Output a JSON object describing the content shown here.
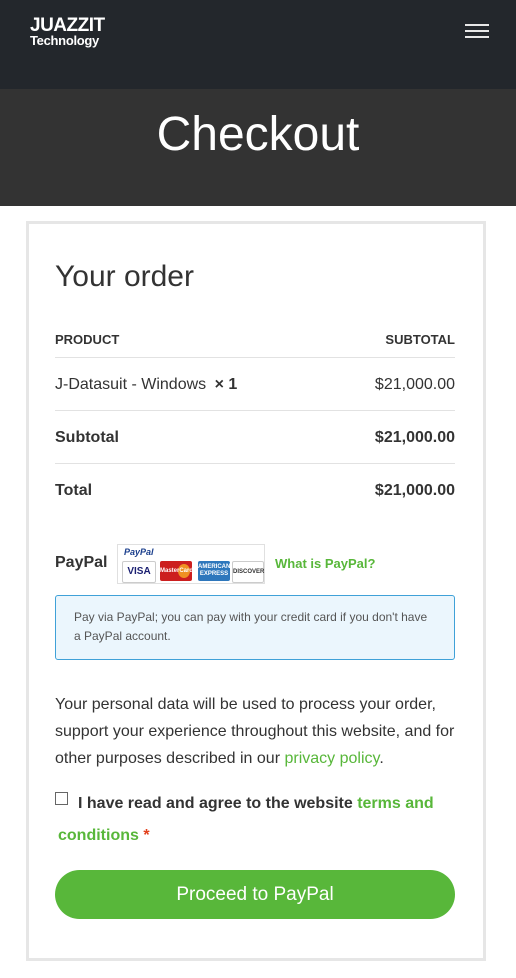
{
  "header": {
    "logo_line1": "JUAZZIT",
    "logo_line2": "Technology",
    "menu_icon": "hamburger-icon"
  },
  "hero": {
    "title": "Checkout"
  },
  "order": {
    "title": "Your order",
    "columns": {
      "product": "PRODUCT",
      "subtotal": "SUBTOTAL"
    },
    "item": {
      "name": "J-Datasuit - Windows",
      "qty": "× 1",
      "price": "$21,000.00"
    },
    "subtotal_label": "Subtotal",
    "subtotal_value": "$21,000.00",
    "total_label": "Total",
    "total_value": "$21,000.00"
  },
  "payment": {
    "method_label": "PayPal",
    "paypal_word": "PayPal",
    "cards": [
      "VISA",
      "MasterCard",
      "AMERICAN EXPRESS",
      "DISCOVER"
    ],
    "what_is_link": "What is PayPal?",
    "info_text": "Pay via PayPal; you can pay with your credit card if you don't have a PayPal account."
  },
  "privacy": {
    "text": "Your personal data will be used to process your order, support your experience throughout this website, and for other purposes described in our ",
    "link": "privacy policy",
    "end": "."
  },
  "terms": {
    "text": "I have read and agree to the website ",
    "link": "terms and conditions",
    "required": "*"
  },
  "proceed_button": "Proceed to PayPal",
  "colors": {
    "accent": "#58b73a",
    "topbar": "#23272c",
    "hero": "#333333",
    "info_border": "#3fa1d8"
  }
}
